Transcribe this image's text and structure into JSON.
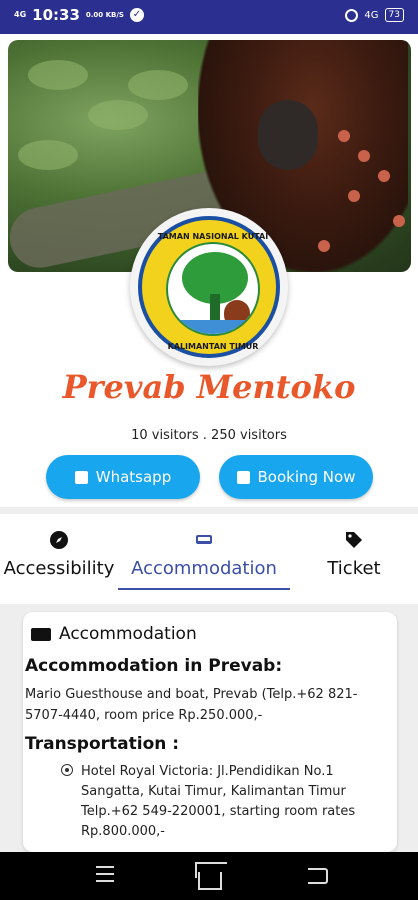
{
  "status_bar": {
    "time": "10:33",
    "network_left": "4G",
    "speed": "0.00 KB/S",
    "network_right": "4G",
    "battery": "73"
  },
  "place": {
    "title": "Prevab Mentoko",
    "visitors": "10  visitors  .  250  visitors"
  },
  "logo": {
    "top_text": "TAMAN NASIONAL KUTAI",
    "bottom_text": "KALIMANTAN TIMUR"
  },
  "actions": {
    "whatsapp_label": "Whatsapp",
    "booking_label": "Booking Now"
  },
  "tabs": [
    {
      "label": "Accessibility",
      "icon": "compass-icon"
    },
    {
      "label": "Accommodation",
      "icon": "sofa-icon",
      "active": true
    },
    {
      "label": "Ticket",
      "icon": "tag-icon"
    }
  ],
  "card": {
    "title": "Accommodation",
    "heading1": "Accommodation in Prevab:",
    "paragraph1": "Mario Guesthouse and boat, Prevab (Telp.+62 821-5707-4440, room price Rp.250.000,-",
    "heading2": "Transportation :",
    "list_item1": "Hotel Royal Victoria: Jl.Pendidikan No.1 Sangatta, Kutai Timur, Kalimantan Timur Telp.+62 549-220001, starting room rates Rp.800.000,-"
  },
  "colors": {
    "status_bar": "#2b2f8f",
    "title": "#e8582a",
    "button": "#18a6ee",
    "active_tab": "#3b4fa8"
  }
}
